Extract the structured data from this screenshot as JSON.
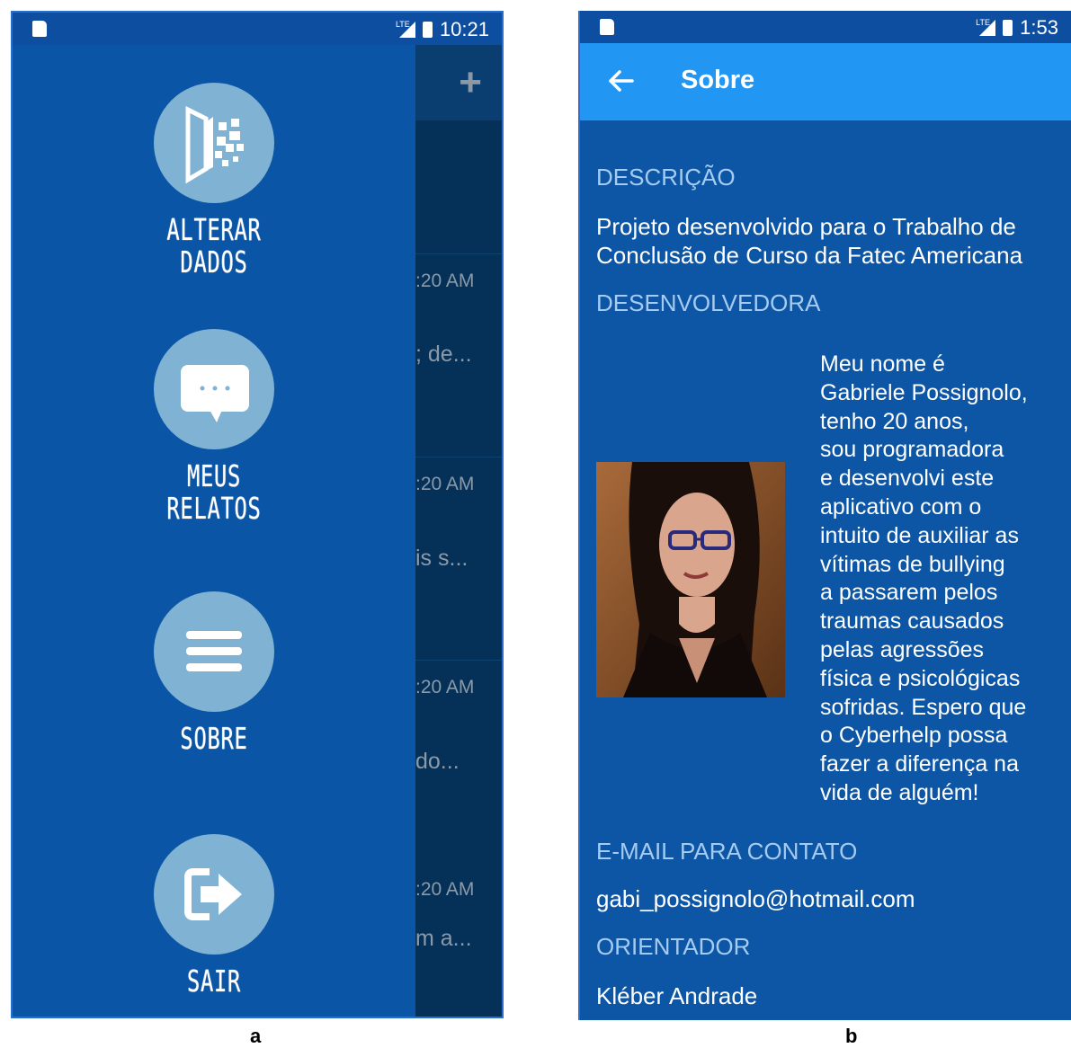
{
  "panel_a": {
    "status_time": "10:21",
    "menu": [
      {
        "label": "ALTERAR\nDADOS",
        "icon": "edit-data-icon"
      },
      {
        "label": "MEUS\nRELATOS",
        "icon": "chat-bubble-icon"
      },
      {
        "label": "SOBRE",
        "icon": "menu-lines-icon"
      },
      {
        "label": "SAIR",
        "icon": "exit-icon"
      }
    ],
    "background_list": {
      "plus_icon": "+",
      "rows": [
        {
          "time": ":20 AM",
          "preview": "; de..."
        },
        {
          "time": ":20 AM",
          "preview": "is s..."
        },
        {
          "time": ":20 AM",
          "preview": "do..."
        },
        {
          "time": ":20 AM",
          "preview": "m a..."
        }
      ]
    },
    "caption": "a"
  },
  "panel_b": {
    "status_time": "1:53",
    "appbar_title": "Sobre",
    "sections": {
      "descricao_head": "DESCRIÇÃO",
      "descricao_text": "Projeto desenvolvido para o Trabalho de Conclusão de Curso da Fatec Americana",
      "desenvolvedora_head": "DESENVOLVEDORA",
      "bio": "Meu nome é\nGabriele Possignolo,\ntenho 20 anos,\nsou programadora\ne desenvolvi este\naplicativo com o\nintuito de auxiliar as\nvítimas de bullying\na passarem pelos\ntraumas causados\npelas agressões\nfísica e psicológicas\nsofridas. Espero que\no Cyberhelp possa\nfazer a diferença na\nvida de alguém!",
      "email_head": "E-MAIL PARA CONTATO",
      "email": "gabi_possignolo@hotmail.com",
      "orientador_head": "ORIENTADOR",
      "orientador": "Kléber Andrade"
    },
    "caption": "b"
  },
  "colors": {
    "drawer_bg": "#0b55a6",
    "circle": "#7fb2d3",
    "appbar": "#2196f3",
    "section_head": "#a6cbf0"
  }
}
